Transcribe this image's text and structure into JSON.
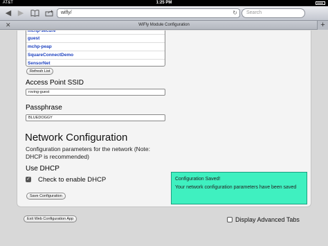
{
  "status_bar": {
    "carrier": "AT&T",
    "time": "1:25 PM"
  },
  "toolbar": {
    "address": "wifly/",
    "search_placeholder": "Search"
  },
  "tab": {
    "title": "WiFly Module Configuration"
  },
  "ssid_list": [
    "mchp-secure",
    "guest",
    "mchp-peap",
    "SquareConnectDemo",
    "SensorNet"
  ],
  "buttons": {
    "refresh": "Refresh List",
    "save": "Save Configuration",
    "exit": "Exit Web Configuration App"
  },
  "access_point": {
    "label": "Access Point SSID",
    "value": "roving-guest"
  },
  "passphrase": {
    "label": "Passphrase",
    "value": "BLUEDOGGY"
  },
  "network": {
    "heading": "Network Configuration",
    "description": "Configuration parameters for the network (Note: DHCP is recommended)",
    "dhcp_label": "Use DHCP",
    "dhcp_checkbox": "Check to enable DHCP",
    "dhcp_checked": true
  },
  "notice": {
    "title": "Configuration Saved!",
    "message": "Your network configuration parameters have been saved",
    "color": "#3ff0c0"
  },
  "advanced": {
    "label": "Display Advanced Tabs",
    "checked": false
  }
}
